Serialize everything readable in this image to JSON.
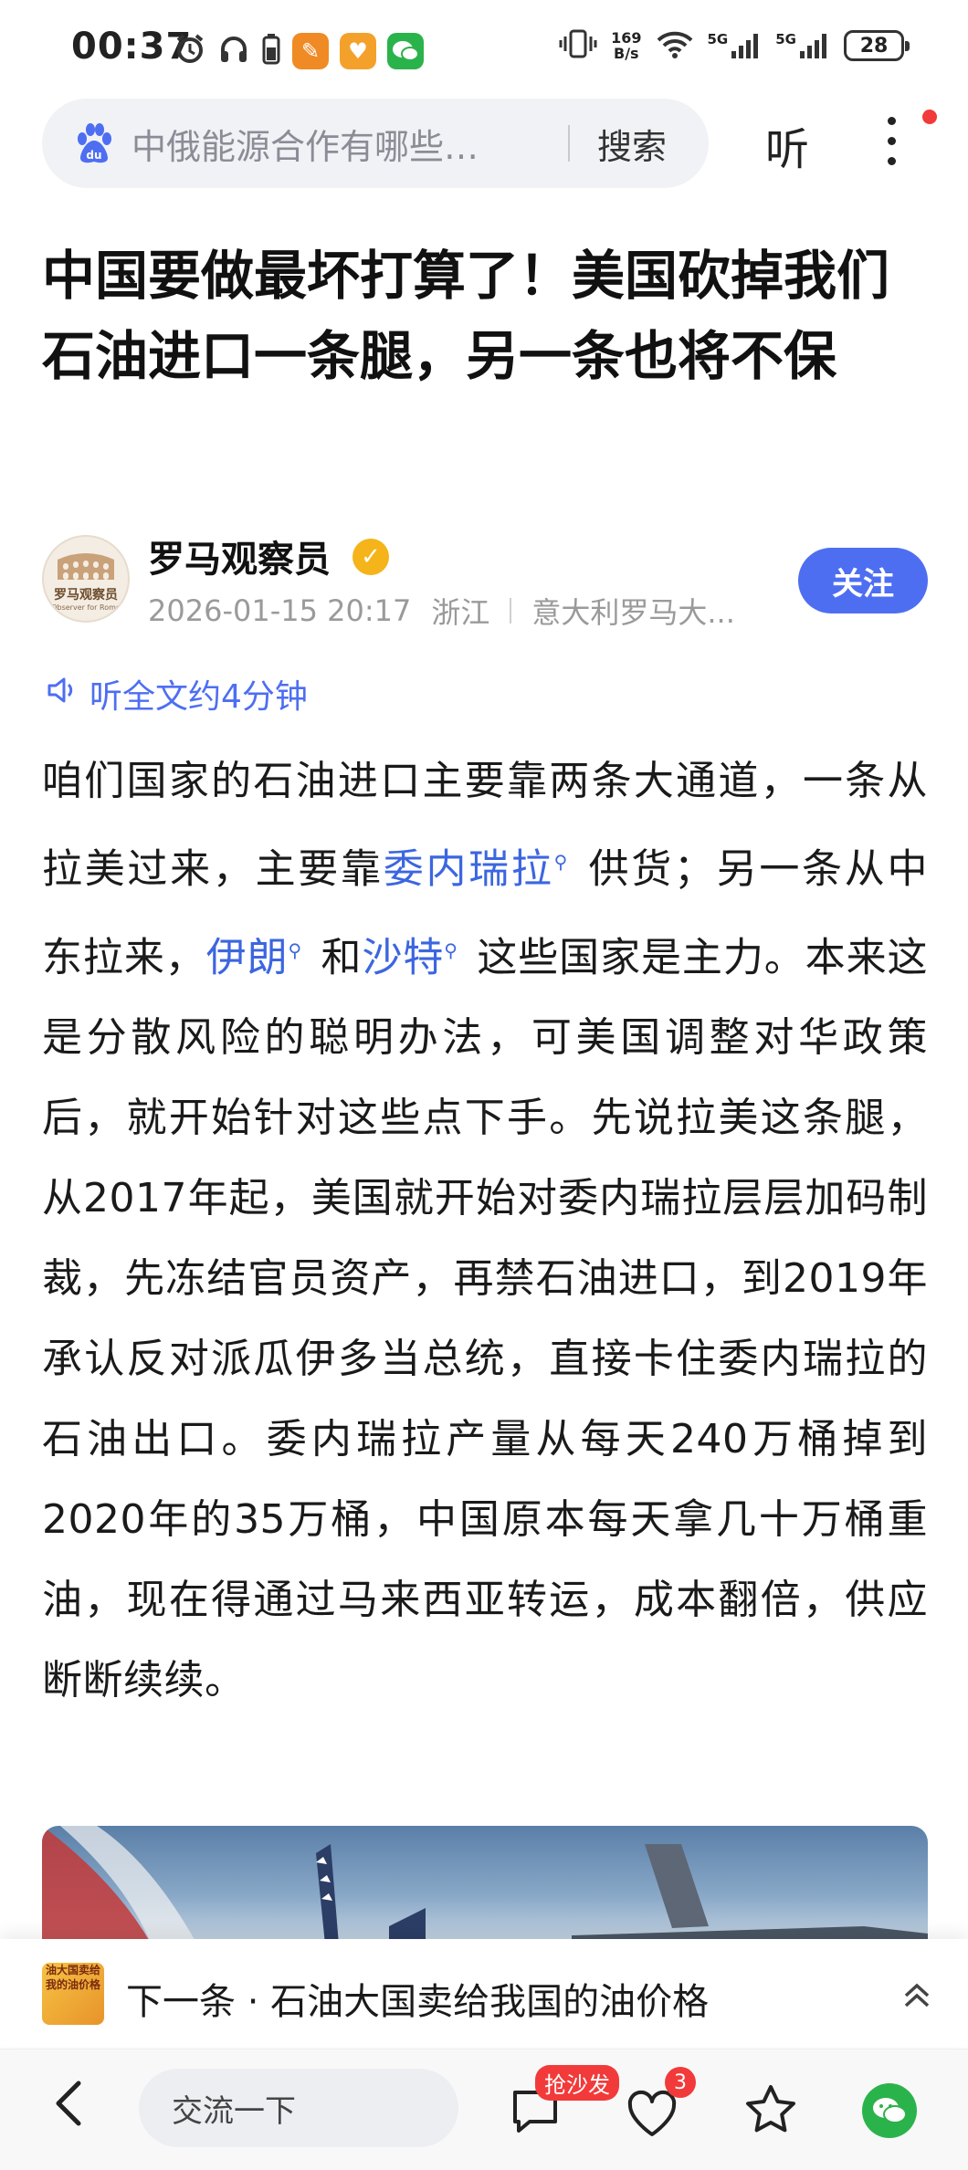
{
  "status_bar": {
    "time": "00:37",
    "net_speed_value": "169",
    "net_speed_unit": "B/s",
    "signal_1": "5G",
    "signal_2": "5G",
    "battery": "28"
  },
  "search": {
    "query": "中俄能源合作有哪些…",
    "button": "搜索"
  },
  "header": {
    "listen_label": "听"
  },
  "article": {
    "title": "中国要做最坏打算了！美国砍掉我们石油进口一条腿，另一条也将不保",
    "author": {
      "name": "罗马观察员",
      "avatar_text": "罗马观察员",
      "avatar_sub": "Observer for Rome",
      "date": "2026-01-15 20:17",
      "location": "浙江",
      "signature": "意大利罗马大..."
    },
    "follow_label": "关注",
    "listen_full": "听全文约4分钟",
    "body": {
      "p1": "咱们国家的石油进口主要靠两条大通道，一条从拉美过来，主要靠",
      "link1": "委内瑞拉",
      "p2": " 供货；另一条从中东拉来，",
      "link2": "伊朗",
      "p3": " 和",
      "link3": "沙特",
      "p4": " 这些国家是主力。本来这是分散风险的聪明办法，可美国调整对华政策后，就开始针对这些点下手。先说拉美这条腿，从2017年起，美国就开始对委内瑞拉层层加码制裁，先冻结官员资产，再禁石油进口，到2019年承认反对派瓜伊多当总统，直接卡住委内瑞拉的石油出口。委内瑞拉产量从每天240万桶掉到2020年的35万桶，中国原本每天拿几十万桶重油，现在得通过马来西亚转运，成本翻倍，供应断断续续。"
    }
  },
  "next": {
    "prefix": "下一条 · ",
    "title": "石油大国卖给我国的油价格",
    "thumb_text": "油大国卖给我的油价格"
  },
  "toolbar": {
    "comment_placeholder": "交流一下",
    "sofa_badge": "抢沙发",
    "like_count": "3"
  },
  "colors": {
    "accent": "#4e6ef2",
    "link": "#3c66e0",
    "badge": "#f23a3a",
    "wechat": "#2bb34b"
  }
}
